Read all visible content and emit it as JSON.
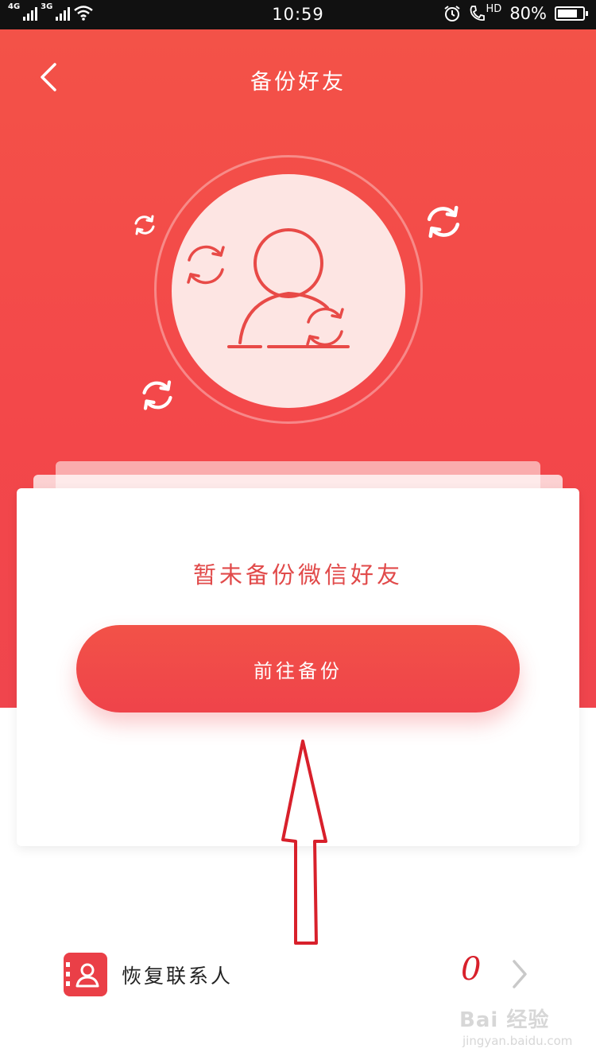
{
  "status_bar": {
    "network1": "4G",
    "network2": "3G",
    "time": "10:59",
    "hd": "HD",
    "battery": "80%",
    "battery_level": 0.8
  },
  "header": {
    "title": "备份好友"
  },
  "card": {
    "message": "暂未备份微信好友",
    "button_label": "前往备份"
  },
  "restore_row": {
    "label": "恢复联系人",
    "count": "0"
  },
  "watermark": {
    "brand": "Bai 经验",
    "url": "jingyan.baidu.com"
  },
  "colors": {
    "accent": "#f3474a",
    "card_text": "#e14a4a"
  }
}
